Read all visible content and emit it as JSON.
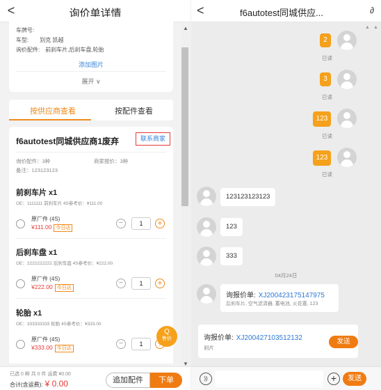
{
  "left": {
    "header": {
      "back": "<",
      "title": "询价单详情"
    },
    "info": {
      "plate_label": "车牌号:",
      "model_label": "车型:",
      "model_value": "别克 凯越",
      "parts_label": "询价配件:",
      "parts_value": "前刹车片,后刹车盘,轮胎",
      "add_image": "添加图片",
      "expand": "展开 ∨"
    },
    "tabs": {
      "by_supplier": "按供应商查看",
      "by_part": "按配件查看"
    },
    "supplier": {
      "name": "f6autotest同城供应商1废弃",
      "contact": "联系商家",
      "inquiry_parts": "询价配件：3种",
      "merchant_quote": "商家报价：3种",
      "note": "备注：123123123"
    },
    "parts": [
      {
        "title": "前刹车片 x1",
        "oe": "OE：1111111  前刹车片  4S参考价：¥111.00",
        "option": "原厂件 (4S)",
        "price": "¥111.00",
        "badge": "今日达",
        "qty": "1"
      },
      {
        "title": "后刹车盘 x1",
        "oe": "OE：2222222222  后刹车盘  4S参考价：¥222.00",
        "option": "原厂件 (4S)",
        "price": "¥222.00",
        "badge": "今日达",
        "qty": "1"
      },
      {
        "title": "轮胎 x1",
        "oe": "OE：333333333  轮胎  4S参考价：¥333.00",
        "option": "原厂件 (4S)",
        "price": "¥333.00",
        "badge": "今日达",
        "qty": "1"
      }
    ],
    "float_quote": {
      "icon": "Q",
      "label": "售价"
    },
    "bottom": {
      "summary": "已选 0 种  共 0 件  运费 ¥0.00",
      "total_label": "合计(含运费):",
      "total_value": "¥ 0.00",
      "add_part": "追加配件",
      "order": "下单"
    }
  },
  "right": {
    "header": {
      "back": "<",
      "title": "f6autotest同城供应...",
      "link_icon": "∂"
    },
    "my_messages": [
      {
        "text": "2",
        "status": "已读"
      },
      {
        "text": "3",
        "status": "已读"
      },
      {
        "text": "123",
        "status": "已读"
      },
      {
        "text": "123",
        "status": "已读"
      }
    ],
    "other_messages": [
      "123123123123",
      "123",
      "333"
    ],
    "date": "04月24日",
    "quote_message": {
      "label": "询报价单:",
      "number": "XJ200423175147975",
      "items": "后刹车片, 空气滤清器, 蓄电池, 火花塞, 123"
    },
    "send_card": {
      "label": "询报价单:",
      "number": "XJ200427103512132",
      "sub": "刹片",
      "send": "发送"
    },
    "input": {
      "voice": "))",
      "add": "+",
      "send": "发送"
    }
  }
}
